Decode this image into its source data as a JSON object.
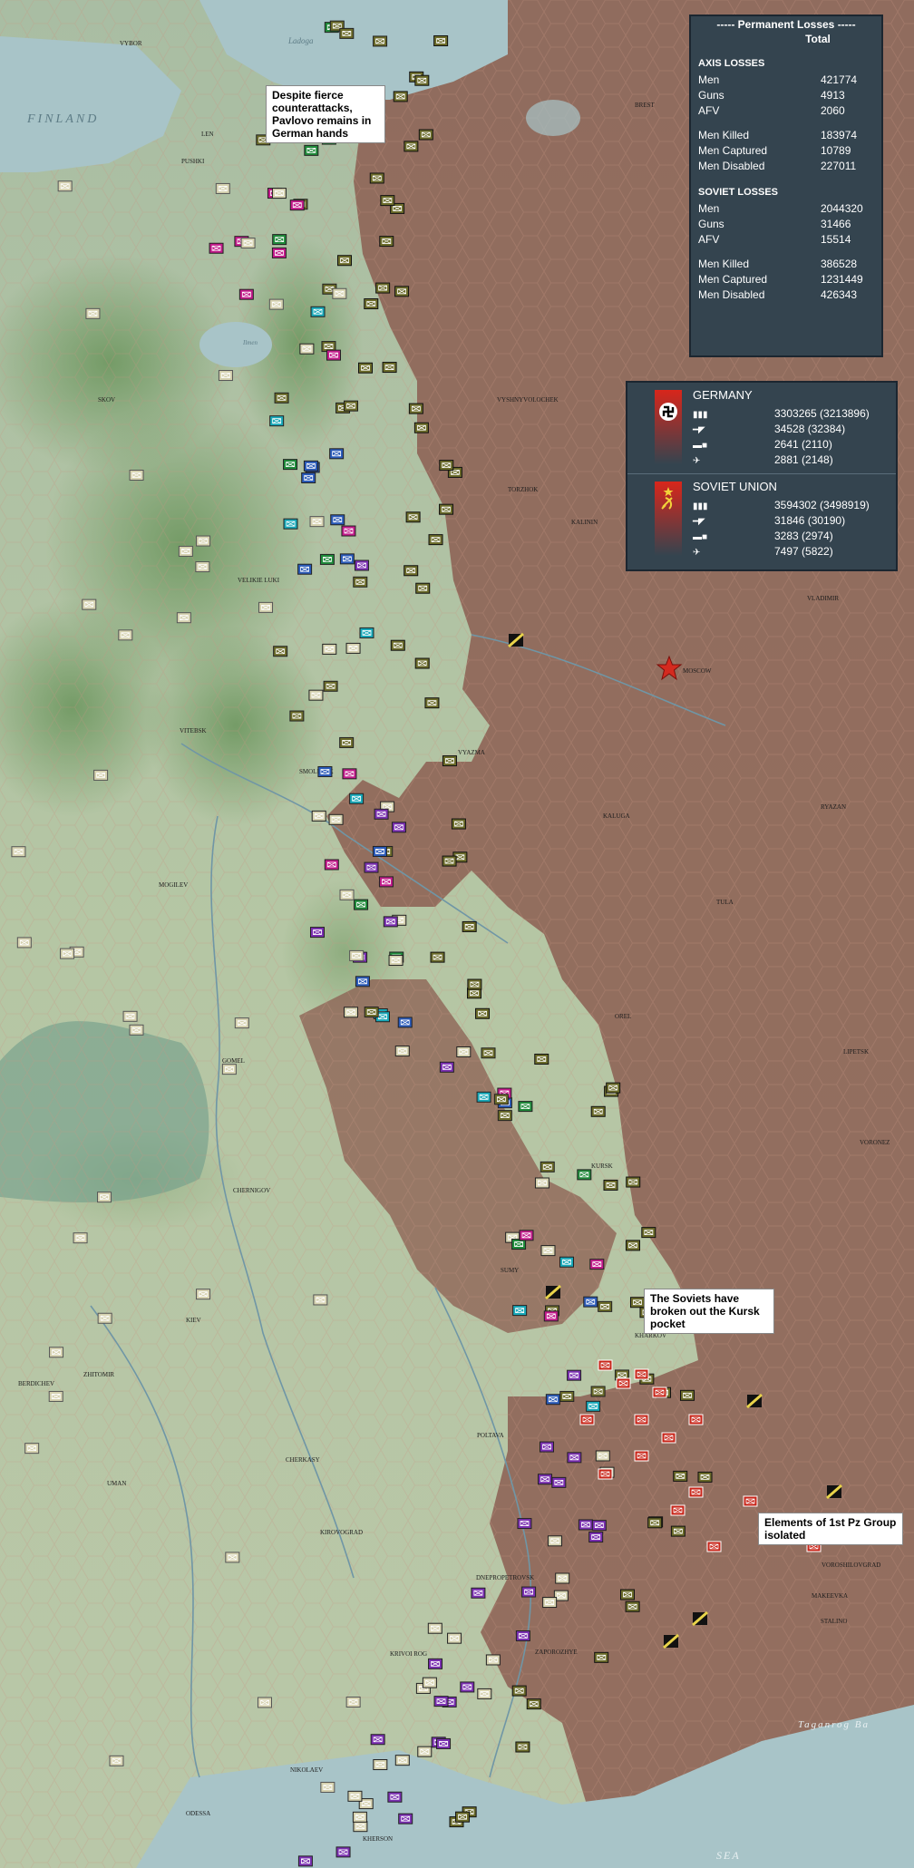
{
  "map": {
    "water_labels": [
      "Ladoga",
      "FINLAND",
      "Ilmen",
      "Taganrog Ba",
      "SEA"
    ],
    "city_labels": [
      "VYBOR",
      "LEN",
      "PUSHKI",
      "SKOV",
      "VYSHNYVOLOCHEK",
      "TORZHOK",
      "KALININ",
      "VELIKIE LUKI",
      "MOSCOW",
      "VLADIMIR",
      "VITEBSK",
      "SMOLENSK",
      "VYAZMA",
      "KALUGA",
      "RYAZAN",
      "MOGILEV",
      "TULA",
      "OREL",
      "GOMEL",
      "LIPETSK",
      "VORONEZ",
      "KURSK",
      "CHERNIGOV",
      "SUMY",
      "KIEV",
      "KHARKOV",
      "POLTAVA",
      "CHERKASY",
      "KIROVOGRAD",
      "DNEPROPETROVSK",
      "ZAPOROZHYE",
      "VOROSHILOVGRAD",
      "MAKEEVKA",
      "STALINO",
      "NIKOLAEV",
      "ODESSA",
      "KRIVOI ROG",
      "UMAN",
      "ZHITOMIR",
      "BERDICHEV",
      "KHERSON",
      "BREST"
    ]
  },
  "annotations": {
    "leningrad": "Despite fierce counterattacks, Pavlovo remains in German hands",
    "kursk": "The Soviets have broken out the Kursk pocket",
    "pz_group": "Elements of 1st Pz Group isolated"
  },
  "losses": {
    "title": "----- Permanent Losses -----",
    "subtitle": "Total",
    "axis_header": "AXIS LOSSES",
    "soviet_header": "SOVIET LOSSES",
    "axis": [
      {
        "label": "Men",
        "value": "421774"
      },
      {
        "label": "Guns",
        "value": "4913"
      },
      {
        "label": "AFV",
        "value": "2060"
      },
      {
        "label": "Men Killed",
        "value": "183974"
      },
      {
        "label": "Men Captured",
        "value": "10789"
      },
      {
        "label": "Men Disabled",
        "value": "227011"
      }
    ],
    "soviet": [
      {
        "label": "Men",
        "value": "2044320"
      },
      {
        "label": "Guns",
        "value": "31466"
      },
      {
        "label": "AFV",
        "value": "15514"
      },
      {
        "label": "Men Killed",
        "value": "386528"
      },
      {
        "label": "Men Captured",
        "value": "1231449"
      },
      {
        "label": "Men Disabled",
        "value": "426343"
      }
    ]
  },
  "comparison": {
    "germany": {
      "name": "GERMANY",
      "color": "#c4211a",
      "stats": [
        {
          "icon": "men-icon",
          "value": "3303265 (3213896)"
        },
        {
          "icon": "gun-icon",
          "value": "34528 (32384)"
        },
        {
          "icon": "tank-icon",
          "value": "2641 (2110)"
        },
        {
          "icon": "aircraft-icon",
          "value": "2881 (2148)"
        }
      ]
    },
    "soviet": {
      "name": "SOVIET UNION",
      "color": "#c4211a",
      "stats": [
        {
          "icon": "men-icon",
          "value": "3594302 (3498919)"
        },
        {
          "icon": "gun-icon",
          "value": "31846 (30190)"
        },
        {
          "icon": "tank-icon",
          "value": "3283 (2974)"
        },
        {
          "icon": "aircraft-icon",
          "value": "7497 (5822)"
        }
      ]
    }
  },
  "colors": {
    "german_front": "#8b5a4a",
    "hex_line": "#c99a85",
    "land": "#a9c1a6",
    "forest": "#7fa26c",
    "water": "#a9c6cc",
    "axis_unit": "#d6d2b0",
    "german_unit": "#6b6b2a",
    "finnish_unit": "#1f8a3a",
    "romanian_unit": "#7a2fb0",
    "italian_unit": "#18a8b8",
    "hungarian_unit": "#c21a8a",
    "soviet_unit": "#c8261a"
  }
}
